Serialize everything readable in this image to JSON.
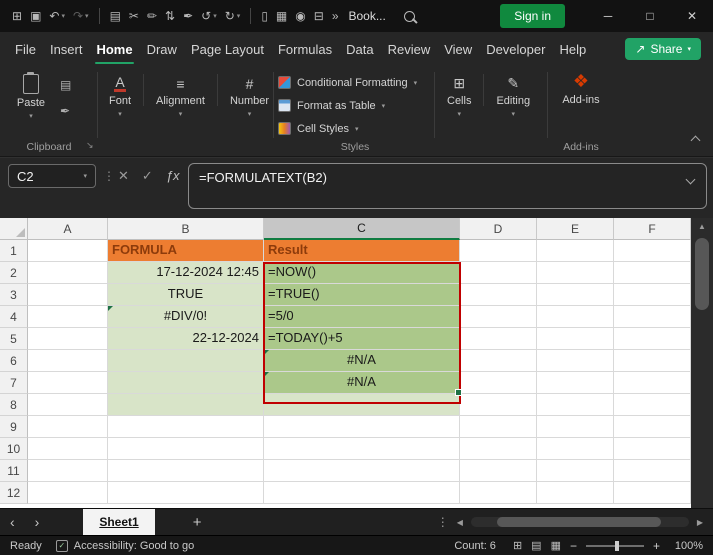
{
  "icons": {
    "caret_down": "▾",
    "dots_vertical": "⋮",
    "dialog_launcher": "↘",
    "scroll_up": "▲",
    "sheet_prev": "‹",
    "sheet_next": "›",
    "sheet_add": "+",
    "sheet_more": "⋮",
    "hscroll_left": "◀",
    "hscroll_right": "▶",
    "zoom_out": "−",
    "zoom_in": "+",
    "share_arrow": "↗",
    "accessibility_check": "✓"
  },
  "titlebar": {
    "qat": [
      {
        "name": "app-grid-icon",
        "glyph": "⊞"
      },
      {
        "name": "save-icon",
        "glyph": "▣"
      },
      {
        "name": "undo-icon",
        "glyph": "↶",
        "caret": true
      },
      {
        "name": "redo-icon",
        "glyph": "↷",
        "caret": true,
        "dim": true
      },
      {
        "sep": true
      },
      {
        "name": "clipboard-icon",
        "glyph": "▤"
      },
      {
        "name": "cut-icon",
        "glyph": "✂"
      },
      {
        "name": "draw-icon",
        "glyph": "✏"
      },
      {
        "name": "sort-icon",
        "glyph": "⇅"
      },
      {
        "name": "format-painter-icon",
        "glyph": "✒"
      },
      {
        "name": "undo-history-icon",
        "glyph": "↺",
        "caret": true
      },
      {
        "name": "redo-history-icon",
        "glyph": "↻",
        "caret": true
      },
      {
        "sep": true
      },
      {
        "name": "new-document-icon",
        "glyph": "▯"
      },
      {
        "name": "table-tools-icon",
        "glyph": "▦"
      },
      {
        "name": "camera-icon",
        "glyph": "◉"
      },
      {
        "name": "zoom-grid-icon",
        "glyph": "⊟"
      },
      {
        "name": "overflow-icon",
        "glyph": "»"
      }
    ],
    "workbook_name": "Book...",
    "sign_in_label": "Sign in",
    "window": {
      "minimize": "─",
      "maximize": "□",
      "close": "✕"
    }
  },
  "menu": {
    "items": [
      "File",
      "Insert",
      "Home",
      "Draw",
      "Page Layout",
      "Formulas",
      "Data",
      "Review",
      "View",
      "Developer",
      "Help"
    ],
    "active": "Home",
    "share_label": "Share"
  },
  "ribbon": {
    "paste_label": "Paste",
    "clipboard_group_label": "Clipboard",
    "small_icons": [
      {
        "name": "copy-icon",
        "glyph": "▤"
      },
      {
        "name": "format-painter-icon",
        "glyph": "✒"
      }
    ],
    "left_collapsed": [
      {
        "label": "Font",
        "icon": "A"
      },
      {
        "label": "Alignment",
        "icon": "≡"
      },
      {
        "label": "Number",
        "icon": "#"
      }
    ],
    "styles_items": [
      "Conditional Formatting",
      "Format as Table",
      "Cell Styles"
    ],
    "styles_group_label": "Styles",
    "right_collapsed": [
      {
        "label": "Cells",
        "icon": "⊞"
      },
      {
        "label": "Editing",
        "icon": "✎"
      }
    ],
    "addins_button_label": "Add-ins",
    "addins_group_label": "Add-ins"
  },
  "formula_bar": {
    "name_box": "C2",
    "formula": "=FORMULATEXT(B2)",
    "icons": {
      "cancel": "✕",
      "enter": "✓",
      "fx": "ƒx"
    }
  },
  "grid": {
    "col_headers": [
      "A",
      "B",
      "C",
      "D",
      "E",
      "F"
    ],
    "selected_col": "C",
    "rows": [
      {
        "n": "1",
        "cells": [
          {},
          {
            "v": "FORMULA",
            "cls": "orange"
          },
          {
            "v": "Result",
            "cls": "orange"
          },
          {},
          {},
          {}
        ]
      },
      {
        "n": "2",
        "cells": [
          {},
          {
            "v": "17-12-2024 12:45",
            "cls": "lightgreen right"
          },
          {
            "v": "=NOW()",
            "cls": "midgreen"
          },
          {},
          {},
          {}
        ]
      },
      {
        "n": "3",
        "cells": [
          {},
          {
            "v": "TRUE",
            "cls": "lightgreen center"
          },
          {
            "v": "=TRUE()",
            "cls": "midgreen"
          },
          {},
          {},
          {}
        ]
      },
      {
        "n": "4",
        "cells": [
          {},
          {
            "v": "#DIV/0!",
            "cls": "lightgreen center",
            "tri": true
          },
          {
            "v": "=5/0",
            "cls": "midgreen"
          },
          {},
          {},
          {}
        ]
      },
      {
        "n": "5",
        "cells": [
          {},
          {
            "v": "22-12-2024",
            "cls": "lightgreen right"
          },
          {
            "v": "=TODAY()+5",
            "cls": "midgreen"
          },
          {},
          {},
          {}
        ]
      },
      {
        "n": "6",
        "cells": [
          {},
          {
            "v": "",
            "cls": "lightgreen"
          },
          {
            "v": "#N/A",
            "cls": "midgreen center",
            "tri": true
          },
          {},
          {},
          {}
        ]
      },
      {
        "n": "7",
        "cells": [
          {},
          {
            "v": "",
            "cls": "lightgreen"
          },
          {
            "v": "#N/A",
            "cls": "midgreen center",
            "tri": true
          },
          {},
          {},
          {}
        ]
      },
      {
        "n": "8",
        "cells": [
          {},
          {
            "v": "",
            "cls": "lightgreen"
          },
          {
            "v": "",
            "cls": "lightgreen"
          },
          {},
          {},
          {}
        ]
      },
      {
        "n": "9",
        "cells": []
      },
      {
        "n": "10",
        "cells": []
      },
      {
        "n": "11",
        "cells": []
      },
      {
        "n": "12",
        "cells": []
      }
    ]
  },
  "sheet_tabs": {
    "active_tab": "Sheet1"
  },
  "status_bar": {
    "mode": "Ready",
    "accessibility": "Accessibility: Good to go",
    "count": "Count: 6",
    "views": [
      "⊞",
      "▤",
      "▦"
    ],
    "zoom": "100%"
  }
}
